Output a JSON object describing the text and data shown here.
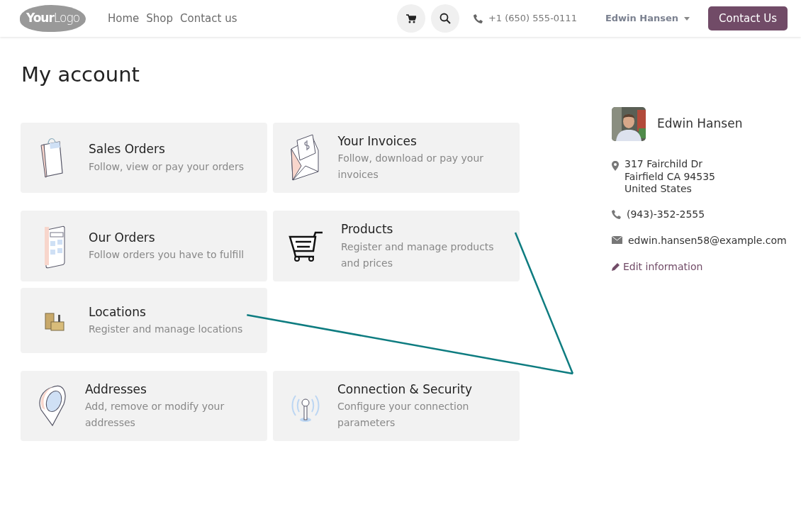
{
  "header": {
    "logo": {
      "bold": "Your",
      "light": "Logo"
    },
    "nav": [
      {
        "label": "Home"
      },
      {
        "label": "Shop"
      },
      {
        "label": "Contact us"
      }
    ],
    "phone": "+1 (650) 555-0111",
    "user": "Edwin Hansen",
    "cta": "Contact Us"
  },
  "title": "My account",
  "sections": [
    {
      "cards": [
        {
          "kind": "bag",
          "title": "Sales Orders",
          "description": "Follow, view or pay your orders",
          "annotated": false
        },
        {
          "kind": "invoice",
          "title": "Your Invoices",
          "description": "Follow, download or pay your invoices",
          "annotated": false
        }
      ]
    },
    {
      "cards": [
        {
          "kind": "calculator",
          "title": "Our Orders",
          "description": "Follow orders you have to fulfill",
          "annotated": false
        },
        {
          "kind": "cart",
          "title": "Products",
          "description": "Register and manage products and prices",
          "annotated": true
        },
        {
          "kind": "warehouse",
          "title": "Locations",
          "description": "Register and manage locations",
          "annotated": true
        }
      ]
    },
    {
      "cards": [
        {
          "kind": "pin",
          "title": "Addresses",
          "description": "Add, remove or modify your addresses",
          "annotated": false
        },
        {
          "kind": "antenna",
          "title": "Connection & Security",
          "description": "Configure your connection parameters",
          "annotated": false
        }
      ]
    }
  ],
  "profile": {
    "name": "Edwin Hansen",
    "address": [
      "317 Fairchild Dr",
      "Fairfield CA 94535",
      "United States"
    ],
    "phone": "(943)-352-2555",
    "email": "edwin.hansen58@example.com",
    "edit": "Edit information"
  }
}
